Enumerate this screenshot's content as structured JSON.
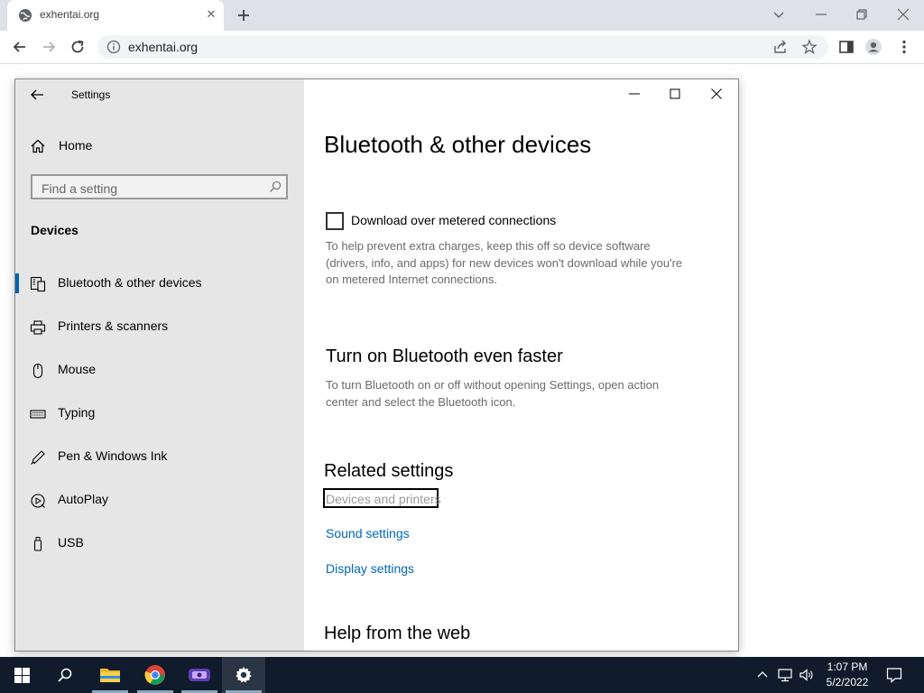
{
  "browser": {
    "tab_title": "exhentai.org",
    "url": "exhentai.org"
  },
  "settings": {
    "app_title": "Settings",
    "home_label": "Home",
    "search_placeholder": "Find a setting",
    "section_label": "Devices",
    "nav_items": [
      {
        "label": "Bluetooth & other devices",
        "icon": "bluetooth-devices-icon",
        "selected": true
      },
      {
        "label": "Printers & scanners",
        "icon": "printer-icon"
      },
      {
        "label": "Mouse",
        "icon": "mouse-icon"
      },
      {
        "label": "Typing",
        "icon": "keyboard-icon"
      },
      {
        "label": "Pen & Windows Ink",
        "icon": "pen-icon"
      },
      {
        "label": "AutoPlay",
        "icon": "autoplay-icon"
      },
      {
        "label": "USB",
        "icon": "usb-icon"
      }
    ],
    "content": {
      "title": "Bluetooth & other devices",
      "metered_checkbox_label": "Download over metered connections",
      "metered_checked": false,
      "metered_desc_lines": [
        "To help prevent extra charges, keep this off so device software",
        "(drivers, info, and apps) for new devices won't download while you're",
        "on metered Internet connections."
      ],
      "bt_faster_title": "Turn on Bluetooth even faster",
      "bt_faster_desc_lines": [
        "To turn Bluetooth on or off without opening Settings, open action",
        "center and select the Bluetooth icon."
      ],
      "related_title": "Related settings",
      "related_links": [
        "Devices and printers",
        "Sound settings",
        "Display settings"
      ],
      "help_title": "Help from the web"
    }
  },
  "taskbar": {
    "time": "1:07 PM",
    "date": "5/2/2022",
    "apps": [
      "start-icon",
      "search-icon",
      "file-explorer-icon",
      "chrome-icon",
      "media-app-icon",
      "settings-gear-icon"
    ]
  },
  "colors": {
    "accent": "#0063b1",
    "link": "#0067b8",
    "taskbar": "#101c2c",
    "sidebar": "#e6e6e6"
  }
}
